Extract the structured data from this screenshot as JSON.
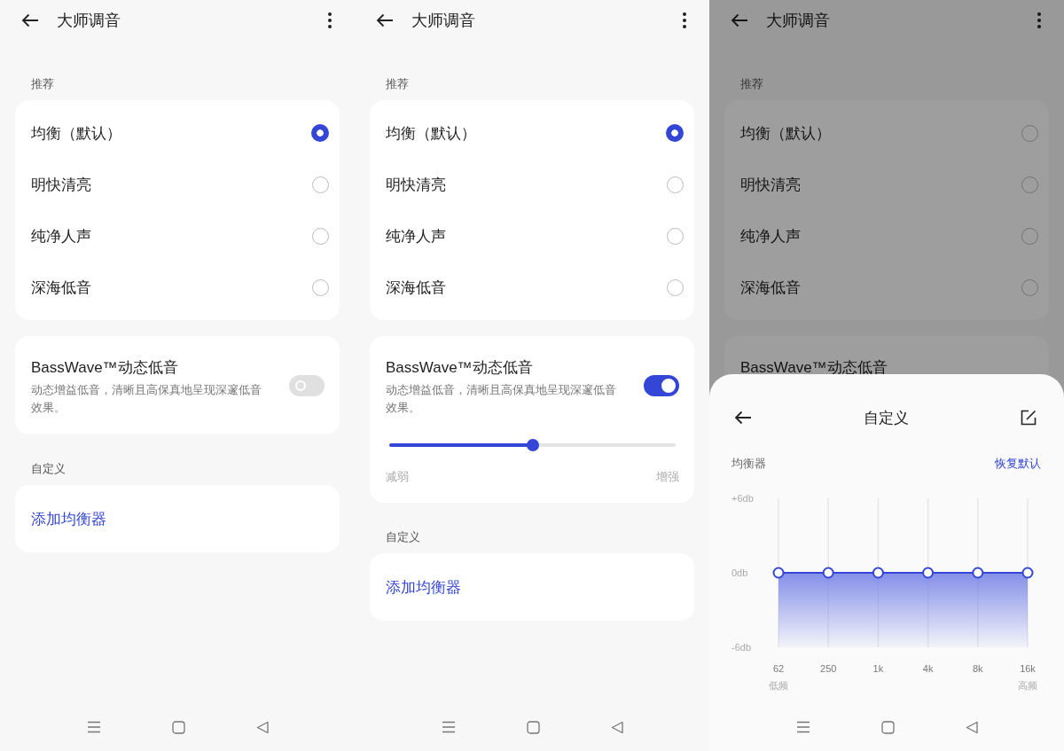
{
  "screens": [
    {
      "title": "大师调音",
      "presets_label": "推荐",
      "presets": [
        {
          "label": "均衡（默认）",
          "selected": true
        },
        {
          "label": "明快清亮",
          "selected": false
        },
        {
          "label": "纯净人声",
          "selected": false
        },
        {
          "label": "深海低音",
          "selected": false
        }
      ],
      "basswave": {
        "title": "BassWave™动态低音",
        "description": "动态增益低音，清晰且高保真地呈现深邃低音效果。",
        "on": false
      },
      "custom_label": "自定义",
      "add_button": "添加均衡器"
    },
    {
      "title": "大师调音",
      "presets_label": "推荐",
      "presets": [
        {
          "label": "均衡（默认）",
          "selected": true
        },
        {
          "label": "明快清亮",
          "selected": false
        },
        {
          "label": "纯净人声",
          "selected": false
        },
        {
          "label": "深海低音",
          "selected": false
        }
      ],
      "basswave": {
        "title": "BassWave™动态低音",
        "description": "动态增益低音，清晰且高保真地呈现深邃低音效果。",
        "on": true,
        "slider": {
          "level": 0.5,
          "min_label": "减弱",
          "max_label": "增强"
        }
      },
      "custom_label": "自定义",
      "add_button": "添加均衡器"
    },
    {
      "title": "大师调音",
      "dimmed": true,
      "presets_label": "推荐",
      "presets": [
        {
          "label": "均衡（默认）",
          "selected": false
        },
        {
          "label": "明快清亮",
          "selected": false
        },
        {
          "label": "纯净人声",
          "selected": false
        },
        {
          "label": "深海低音",
          "selected": false
        }
      ],
      "basswave": {
        "title": "BassWave™动态低音"
      },
      "sheet": {
        "title": "自定义",
        "reset_link": "恢复默认",
        "low_label": "低频",
        "high_label": "高频",
        "chart_data": {
          "type": "line",
          "categories": [
            "62",
            "250",
            "1k",
            "4k",
            "8k",
            "16k"
          ],
          "ylim": [
            -6,
            6
          ],
          "grid": true,
          "yticks": [
            {
              "value": 6,
              "label": "+6db"
            },
            {
              "value": 0,
              "label": "0db"
            },
            {
              "value": -6,
              "label": "-6db"
            }
          ],
          "series": [
            {
              "name": "均衡器",
              "color": "#3446d6",
              "marker": true,
              "values": [
                0,
                0,
                0,
                0,
                0,
                0
              ]
            }
          ]
        }
      }
    }
  ]
}
